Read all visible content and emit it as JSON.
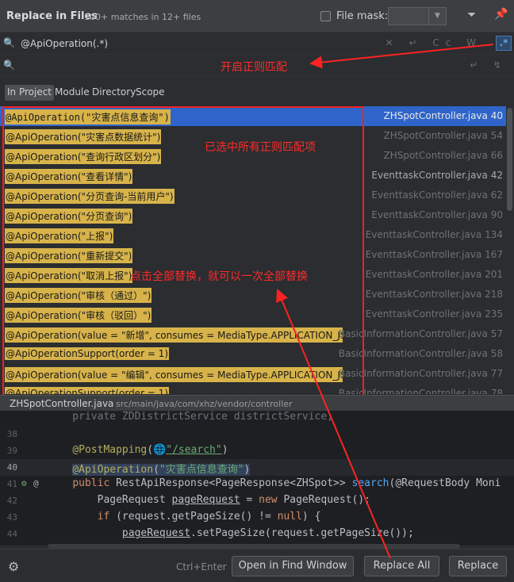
{
  "dialog": {
    "title": "Replace in Files",
    "subtitle": "100+ matches in 12+ files",
    "file_mask_label": "File mask:",
    "file_mask_value": ""
  },
  "search": {
    "query": "@ApiOperation(.*)",
    "replace": ""
  },
  "scope": {
    "tabs": [
      "In Project",
      "Module",
      "Directory",
      "Scope"
    ],
    "active": "In Project"
  },
  "results": [
    {
      "match": "@ApiOperation(\"灾害点信息查询\")",
      "file": "ZHSpotController.java",
      "line": "40"
    },
    {
      "match": "@ApiOperation(\"灾害点数据统计\")",
      "file": "ZHSpotController.java",
      "line": "54"
    },
    {
      "match": "@ApiOperation(\"查询行政区划分\")",
      "file": "ZHSpotController.java",
      "line": "66"
    },
    {
      "match": "@ApiOperation(\"查看详情\")",
      "file": "EventtaskController.java",
      "line": "42"
    },
    {
      "match": "@ApiOperation(\"分页查询-当前用户\")",
      "file": "EventtaskController.java",
      "line": "62"
    },
    {
      "match": "@ApiOperation(\"分页查询\")",
      "file": "EventtaskController.java",
      "line": "90"
    },
    {
      "match": "@ApiOperation(\"上报\")",
      "file": "EventtaskController.java",
      "line": "134"
    },
    {
      "match": "@ApiOperation(\"重新提交\")",
      "file": "EventtaskController.java",
      "line": "167"
    },
    {
      "match": "@ApiOperation(\"取消上报\")",
      "file": "EventtaskController.java",
      "line": "201"
    },
    {
      "match": "@ApiOperation(\"审核（通过）\")",
      "file": "EventtaskController.java",
      "line": "218"
    },
    {
      "match": "@ApiOperation(\"审核（驳回）\")",
      "file": "EventtaskController.java",
      "line": "235"
    },
    {
      "match": "@ApiOperation(value = \"新增\", consumes = MediaType.APPLICATION_JSO",
      "file": "BasicInformationController.java",
      "line": "57"
    },
    {
      "match": "@ApiOperationSupport(order = 1)",
      "file": "BasicInformationController.java",
      "line": "58"
    },
    {
      "match": "@ApiOperation(value = \"编辑\", consumes = MediaType.APPLICATION_JSO",
      "file": "BasicInformationController.java",
      "line": "77"
    },
    {
      "match": "@ApiOperationSupport(order = 1)",
      "file": "BasicInformationController.java",
      "line": "78"
    }
  ],
  "annotations": {
    "regex_note": "开启正则匹配",
    "selected_note": "已选中所有正则匹配项",
    "replace_all_note": "点击全部替换，就可以一次全部替换"
  },
  "path": {
    "file": "ZHSpotController.java",
    "dir": "src/main/java/com/xhz/vendor/controller"
  },
  "code": {
    "line_38": "38",
    "line_39": "39",
    "line_40": "40",
    "line_41": "41",
    "line_42": "42",
    "line_43": "43",
    "line_44": "44",
    "line_37_text": "    private ZDDistrictService districtService;",
    "line_39_anno": "@PostMapping",
    "line_39_path": "\"/search\"",
    "line_40_anno": "@ApiOperation",
    "line_40_str": "\"灾害点信息查询\"",
    "line_41_text": "RestApiResponse<PageResponse<ZHSpot>> ",
    "line_41_fn": "search",
    "line_41_rest": "(@RequestBody Moni",
    "line_42_var": "pageRequest",
    "line_42_rest": " = ",
    "line_42_new": "PageRequest();",
    "line_43_text": "(request.getPageSize() != ",
    "line_44_var": "pageRequest",
    "line_44_rest": ".setPageSize(request.getPageSize());"
  },
  "footer": {
    "shortcut": "Ctrl+Enter",
    "open_button": "Open in Find Window",
    "replace_all_button": "Replace All",
    "replace_button": "Replace"
  }
}
